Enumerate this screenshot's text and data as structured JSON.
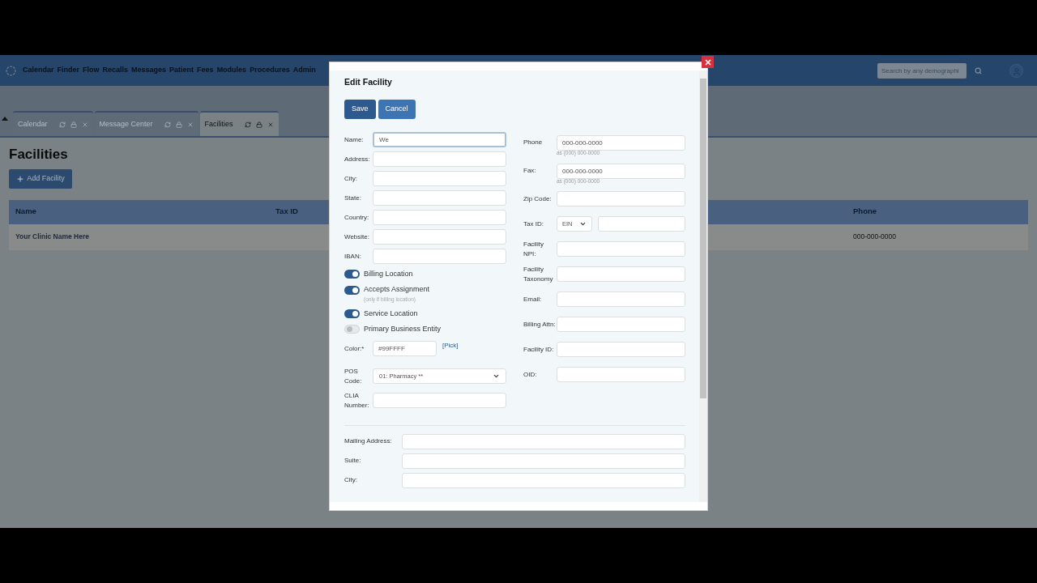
{
  "nav": {
    "items": [
      "Calendar",
      "Finder",
      "Flow",
      "Recalls",
      "Messages",
      "Patient",
      "Fees",
      "Modules",
      "Procedures",
      "Admin"
    ],
    "search_placeholder": "Search by any demographi"
  },
  "tabs": [
    {
      "label": "Calendar",
      "selected": false
    },
    {
      "label": "Message Center",
      "selected": false
    },
    {
      "label": "Facilities",
      "selected": true
    }
  ],
  "page": {
    "title": "Facilities",
    "add_button": "Add Facility"
  },
  "table": {
    "columns": [
      "Name",
      "Tax ID",
      "Phone"
    ],
    "rows": [
      {
        "name": "Your Clinic Name Here",
        "phone": "000-000-0000"
      }
    ]
  },
  "modal": {
    "title": "Edit Facility",
    "buttons": [
      {
        "label": "Save",
        "kind": "primary"
      },
      {
        "label": "Cancel",
        "kind": "secondary"
      }
    ],
    "left": [
      {
        "kind": "text",
        "label": "Name:",
        "value": "We",
        "focused": true
      },
      {
        "kind": "text",
        "label": "Address:"
      },
      {
        "kind": "text",
        "label": "City:"
      },
      {
        "kind": "text",
        "label": "State:"
      },
      {
        "kind": "text",
        "label": "Country:"
      },
      {
        "kind": "text",
        "label": "Website:"
      },
      {
        "kind": "text",
        "label": "IBAN:"
      },
      {
        "kind": "toggle",
        "label": "Billing Location",
        "on": true
      },
      {
        "kind": "toggle",
        "label": "Accepts Assignment",
        "on": true,
        "hint": "(only if billing location)"
      },
      {
        "kind": "toggle",
        "label": "Service Location",
        "on": true
      },
      {
        "kind": "toggle",
        "label": "Primary Business Entity",
        "on": false
      },
      {
        "kind": "color",
        "label": "Color:*",
        "value": "#99FFFF",
        "link": "[Pick]"
      },
      {
        "kind": "select",
        "label": "POS Code:",
        "value": "01: Pharmacy **"
      },
      {
        "kind": "text",
        "label": "CLIA Number:"
      }
    ],
    "right": [
      {
        "kind": "text",
        "label": "Phone",
        "placeholder": "000-000-0000",
        "hint": "as (000) 000-0000"
      },
      {
        "kind": "text",
        "label": "Fax:",
        "placeholder": "000-000-0000",
        "hint": "as (000) 000-0000"
      },
      {
        "kind": "text",
        "label": "Zip Code:"
      },
      {
        "kind": "taxid",
        "label": "Tax ID:",
        "value": "EIN"
      },
      {
        "kind": "text",
        "label": "Facility NPI:"
      },
      {
        "kind": "text",
        "label": "Facility Taxonomy"
      },
      {
        "kind": "text",
        "label": "Email:"
      },
      {
        "kind": "text",
        "label": "Billing Attn:"
      },
      {
        "kind": "text",
        "label": "Facility ID:"
      },
      {
        "kind": "text",
        "label": "OID:"
      }
    ],
    "mailing": [
      {
        "label": "Mailing Address:"
      },
      {
        "label": "Suite:"
      },
      {
        "label": "City:"
      }
    ]
  }
}
